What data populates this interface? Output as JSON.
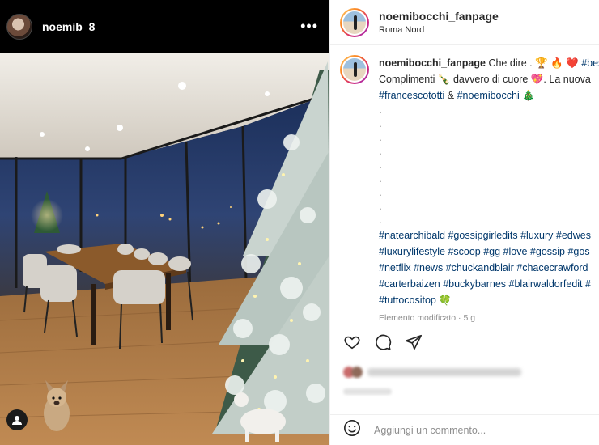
{
  "left": {
    "username": "noemib_8",
    "more_glyph": "•••",
    "photo_icon": "tag-people-icon"
  },
  "post": {
    "author": "noemibocchi_fanpage",
    "location": "Roma Nord",
    "caption_lines": [
      {
        "user": "noemibocchi_fanpage",
        "text": " Che dire . 🏆 🔥 ❤️ ",
        "tag": "#bes"
      },
      {
        "text": "Complimenti 🍾 davvero di cuore 💖. La nuova"
      },
      {
        "tag_a": "#francescototti",
        "mid": " & ",
        "tag_b": "#noemibocchi",
        "tail": " 🎄"
      }
    ],
    "dots": [
      ".",
      ".",
      ".",
      ".",
      ".",
      ".",
      ".",
      ".",
      "."
    ],
    "hashtag_lines": [
      "#natearchibald #gossipgirledits #luxury #edwes",
      "#luxurylifestyle #scoop #gg #love #gossip #gos",
      "#netflix #news #chuckandblair #chacecrawford",
      "#carterbaizen #buckybarnes #blairwaldorfedit #"
    ],
    "last_tag": "#tuttocositop",
    "last_emoji": "🍀",
    "edited": "Elemento modificato · 5 g",
    "comment_placeholder": "Aggiungi un commento..."
  },
  "icons": [
    "like-heart-icon",
    "comment-bubble-icon",
    "share-plane-icon",
    "emoji-smiley-icon"
  ],
  "colors": {
    "hashtag": "#00376b",
    "text": "#262626",
    "muted": "#8e8e8e"
  }
}
